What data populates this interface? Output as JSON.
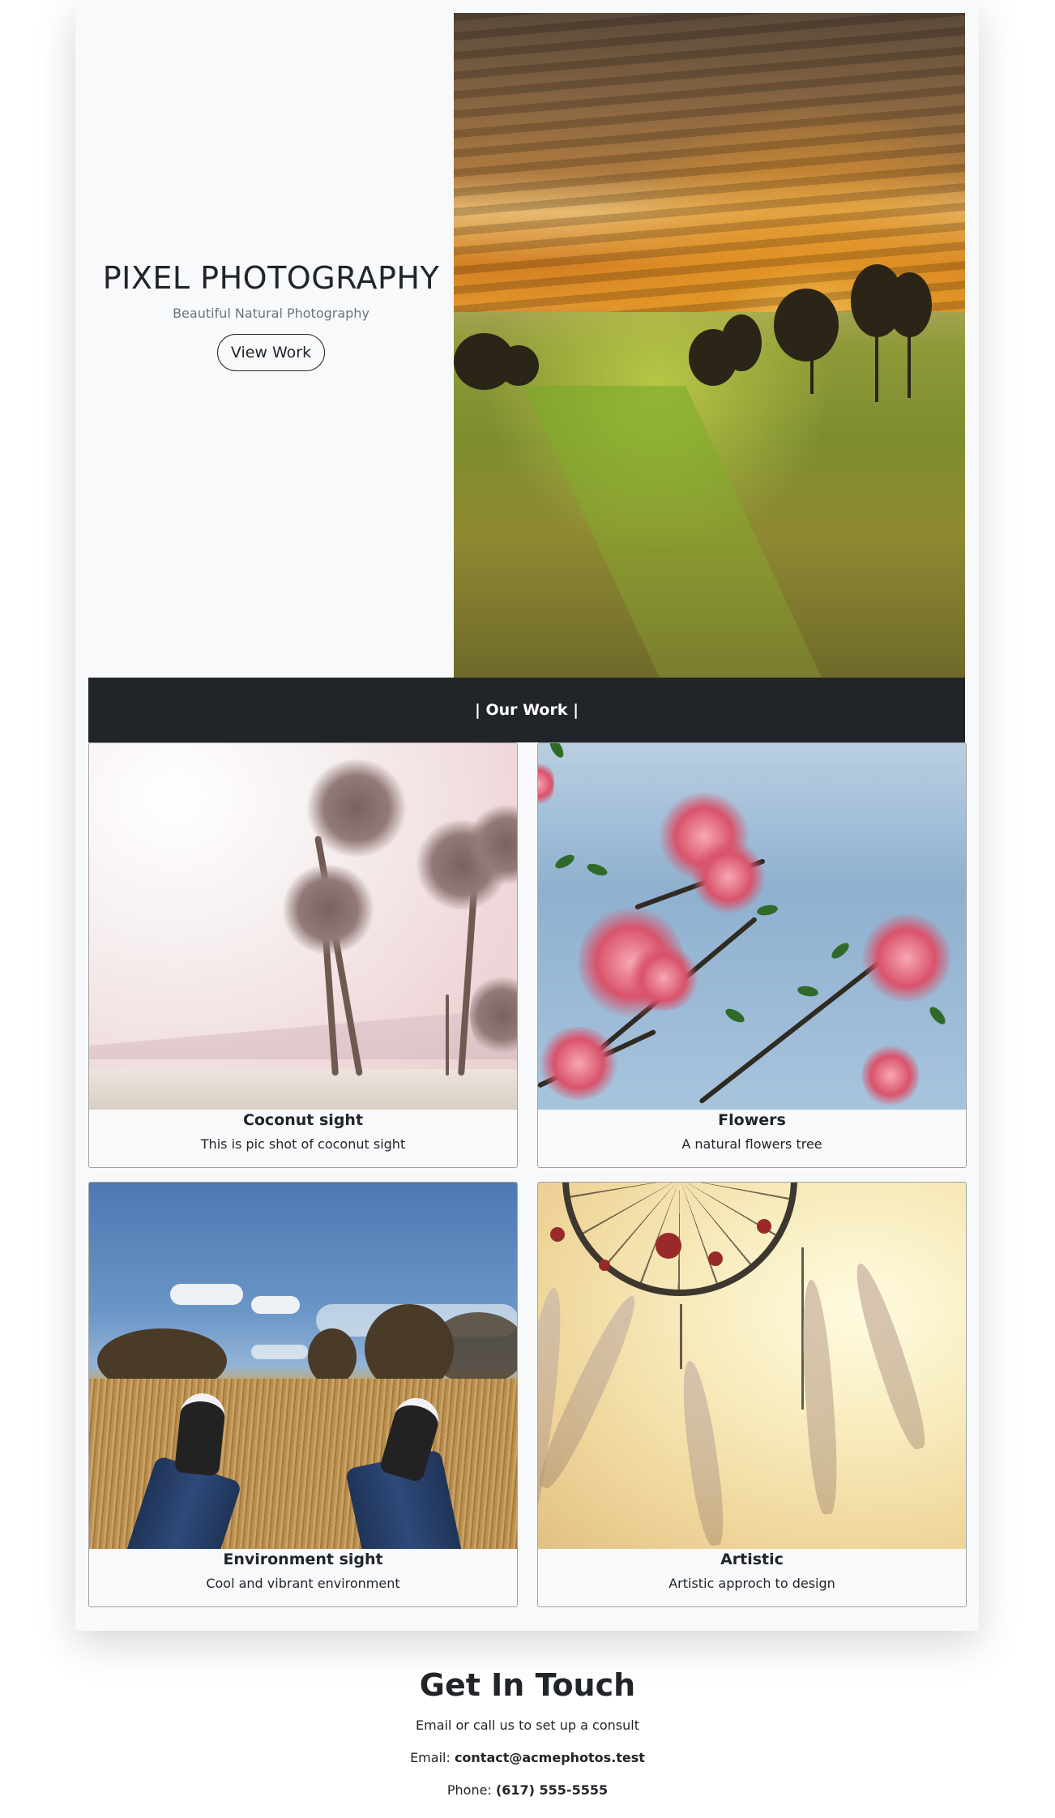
{
  "hero": {
    "title": "PIXEL PHOTOGRAPHY",
    "subtitle": "Beautiful Natural Photography",
    "button_label": "View Work",
    "image_alt": "sunset-over-grass-field"
  },
  "work": {
    "heading": "| Our Work |",
    "cards": [
      {
        "title": "Coconut sight",
        "text": "This is pic shot of coconut sight",
        "image": "palm-trees-beach"
      },
      {
        "title": "Flowers",
        "text": "A natural flowers tree",
        "image": "pink-flowers-blue-sky"
      },
      {
        "title": "Environment sight",
        "text": "Cool and vibrant environment",
        "image": "sneakers-on-grass-field"
      },
      {
        "title": "Artistic",
        "text": "Artistic approch to design",
        "image": "dreamcatcher-in-sunlight"
      }
    ]
  },
  "contact": {
    "heading": "Get In Touch",
    "intro": "Email or call us to set up a consult",
    "email_label": "Email:",
    "email_value": "contact@acmephotos.test",
    "phone_label": "Phone:",
    "phone_value": "(617) 555-5555"
  },
  "colors": {
    "panel_bg": "#f8f9fa",
    "dark_bar": "#212529",
    "text": "#212529",
    "muted": "#6c757d"
  }
}
